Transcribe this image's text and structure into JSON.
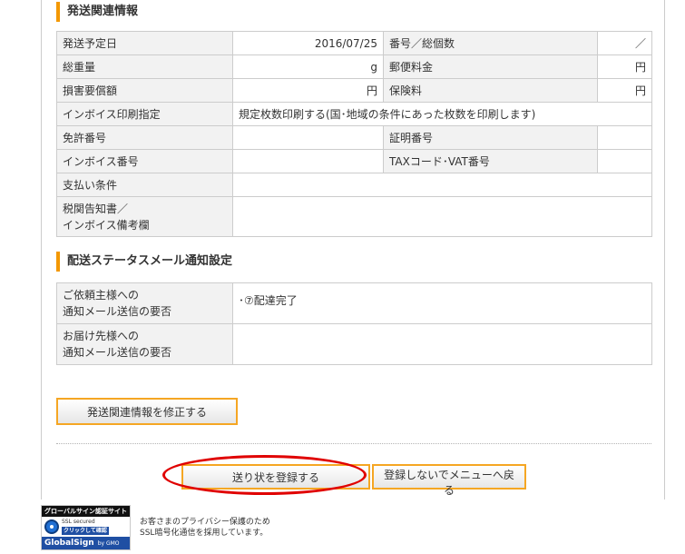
{
  "shipping_section": {
    "title": "発送関連情報",
    "rows": [
      {
        "label1": "発送予定日",
        "value1": "2016/07/25",
        "label2": "番号／総個数",
        "value2": "／"
      },
      {
        "label1": "総重量",
        "value1": "g",
        "label2": "郵便料金",
        "value2": "円"
      },
      {
        "label1": "損害要償額",
        "value1": "円",
        "label2": "保険料",
        "value2": "円"
      },
      {
        "label1": "インボイス印刷指定",
        "value1": "規定枚数印刷する(国･地域の条件にあった枚数を印刷します)"
      },
      {
        "label1": "免許番号",
        "value1": "",
        "label2": "証明番号",
        "value2": ""
      },
      {
        "label1": "インボイス番号",
        "value1": "",
        "label2": "TAXコード･VAT番号",
        "value2": ""
      },
      {
        "label1": "支払い条件",
        "value1": ""
      },
      {
        "label1_line1": "税関告知書／",
        "label1_line2": "インボイス備考欄",
        "value1": ""
      }
    ]
  },
  "notification_section": {
    "title": "配送ステータスメール通知設定",
    "rows": [
      {
        "label_line1": "ご依頼主様への",
        "label_line2": "通知メール送信の要否",
        "value": "･⑦配達完了"
      },
      {
        "label_line1": "お届け先様への",
        "label_line2": "通知メール送信の要否",
        "value": ""
      }
    ]
  },
  "buttons": {
    "edit_shipping": "発送関連情報を修正する",
    "register_label": "送り状を登録する",
    "back_to_menu": "登録しないでメニューへ戻る"
  },
  "ssl_badge": {
    "header": "グローバルサイン認証サイト",
    "ssl_text": "SSL secured",
    "click_text": "クリックして確認",
    "brand": "GlobalSign",
    "brand_by": "by GMO"
  },
  "ssl_note": {
    "line1": "お客さまのプライバシー保護のため",
    "line2": "SSL暗号化通信を採用しています。"
  },
  "colors": {
    "accent": "#f39800",
    "button_border": "#f5a623",
    "highlight": "#e00000",
    "label_bg": "#f2f2f2",
    "border": "#cccccc"
  }
}
